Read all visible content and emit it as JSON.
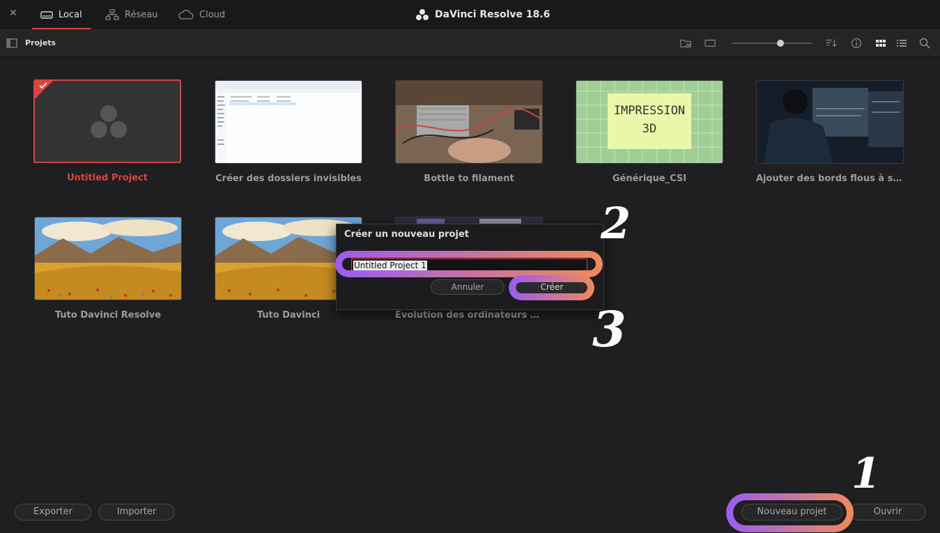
{
  "window": {
    "title": "DaVinci Resolve 18.6"
  },
  "tabs": [
    {
      "label": "Local",
      "active": true
    },
    {
      "label": "Réseau",
      "active": false
    },
    {
      "label": "Cloud",
      "active": false
    }
  ],
  "toolbar": {
    "title": "Projets",
    "zoom_level": 0.6
  },
  "projects": [
    {
      "label": "Untitled Project",
      "selected": true
    },
    {
      "label": "Créer des dossiers invisibles"
    },
    {
      "label": "Bottle to filament"
    },
    {
      "label": "Générique_CSI",
      "thumb_text": [
        "IMPRESSION",
        "3D"
      ]
    },
    {
      "label": "Ajouter des bords flous à sa vid..."
    },
    {
      "label": "Tuto Davinci Resolve"
    },
    {
      "label": "Tuto Davinci"
    },
    {
      "label": "Évolution des ordinateurs - Short"
    }
  ],
  "dialog": {
    "title": "Créer un nouveau projet",
    "input_value": "Untitled Project 1",
    "cancel_label": "Annuler",
    "create_label": "Créer"
  },
  "footer": {
    "export_label": "Exporter",
    "import_label": "Importer",
    "new_project_label": "Nouveau projet",
    "open_label": "Ouvrir"
  },
  "annotations": [
    "1",
    "2",
    "3"
  ],
  "colors": {
    "accent": "#d8453f",
    "ring_start": "#9b5cf2",
    "ring_end": "#f08a5a"
  }
}
